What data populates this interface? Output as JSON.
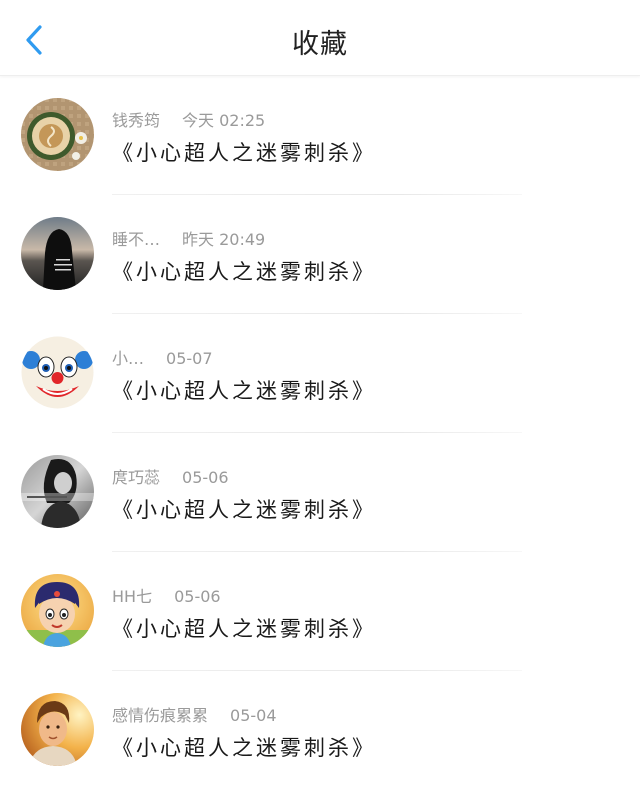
{
  "header": {
    "title": "收藏"
  },
  "favorites": [
    {
      "author": "钱秀筠",
      "time": "今天 02:25",
      "content": "《小心超人之迷雾刺杀》",
      "avatar": "coffee-latte-avatar"
    },
    {
      "author": "睡不…",
      "time": "昨天 20:49",
      "content": "《小心超人之迷雾刺杀》",
      "avatar": "hooded-figure-avatar"
    },
    {
      "author": "小…",
      "time": "05-07",
      "content": "《小心超人之迷雾刺杀》",
      "avatar": "clown-face-avatar"
    },
    {
      "author": "庹巧蕊",
      "time": "05-06",
      "content": "《小心超人之迷雾刺杀》",
      "avatar": "bw-portrait-avatar"
    },
    {
      "author": "HH七",
      "time": "05-06",
      "content": "《小心超人之迷雾刺杀》",
      "avatar": "cartoon-character-avatar"
    },
    {
      "author": "感情伤痕累累",
      "time": "05-04",
      "content": "《小心超人之迷雾刺杀》",
      "avatar": "sunlit-portrait-avatar"
    }
  ],
  "colors": {
    "accent": "#2f9bf0",
    "text": "#1a1a1a",
    "meta": "#9a9a9a"
  }
}
